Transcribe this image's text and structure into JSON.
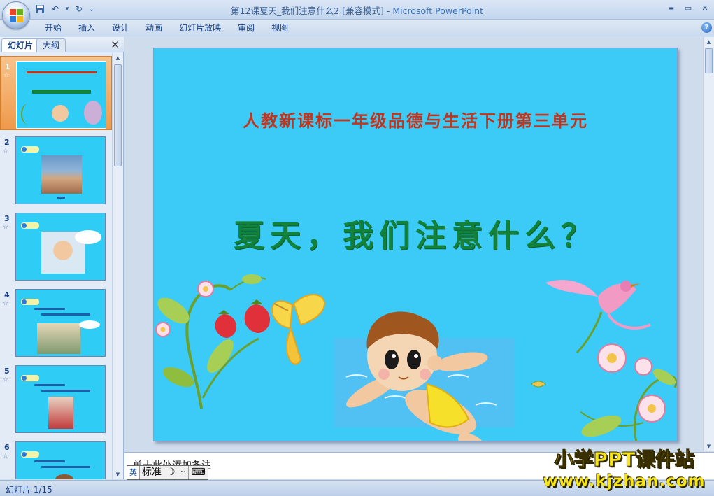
{
  "window": {
    "title": "第12课夏天_我们注意什么2 [兼容模式]",
    "separator": " - ",
    "app_name": "Microsoft PowerPoint",
    "minimize_glyph": "▬",
    "restore_glyph": "▭",
    "close_glyph": "✕"
  },
  "quick_access": {
    "save_icon": "save-icon",
    "undo_icon": "undo-icon",
    "redo_icon": "redo-icon",
    "undo_glyph": "↶",
    "redo_glyph": "↻",
    "dropdown_glyph": "▾",
    "customize_glyph": "⌄"
  },
  "ribbon": {
    "tabs": [
      {
        "label": "开始"
      },
      {
        "label": "插入"
      },
      {
        "label": "设计"
      },
      {
        "label": "动画"
      },
      {
        "label": "幻灯片放映"
      },
      {
        "label": "审阅"
      },
      {
        "label": "视图"
      }
    ],
    "help_glyph": "?"
  },
  "left_panel": {
    "tab_slides": "幻灯片",
    "tab_outline": "大纲",
    "close_glyph": "✕",
    "thumbnails": [
      {
        "number": "1",
        "selected": true
      },
      {
        "number": "2",
        "selected": false
      },
      {
        "number": "3",
        "selected": false
      },
      {
        "number": "4",
        "selected": false
      },
      {
        "number": "5",
        "selected": false
      },
      {
        "number": "6",
        "selected": false
      }
    ],
    "star_glyph": "☆",
    "scroll_up": "▲",
    "scroll_down": "▼"
  },
  "slide": {
    "subtitle": "人教新课标一年级品德与生活下册第三单元",
    "title": "夏天，我们注意什么？",
    "background_color": "#3ccbf7",
    "title_color": "#12813a",
    "subtitle_color": "#c2341c"
  },
  "notes": {
    "placeholder": "单击此处添加备注"
  },
  "ime": {
    "mode": "标准",
    "icon1": "英",
    "moon": "☽",
    "dots": "··",
    "keyboard": "⌨"
  },
  "status": {
    "slide_info": "幻灯片 1/15"
  },
  "watermark": {
    "line1": "小学PPT课件站",
    "line2": "www.kjzhan.com"
  }
}
